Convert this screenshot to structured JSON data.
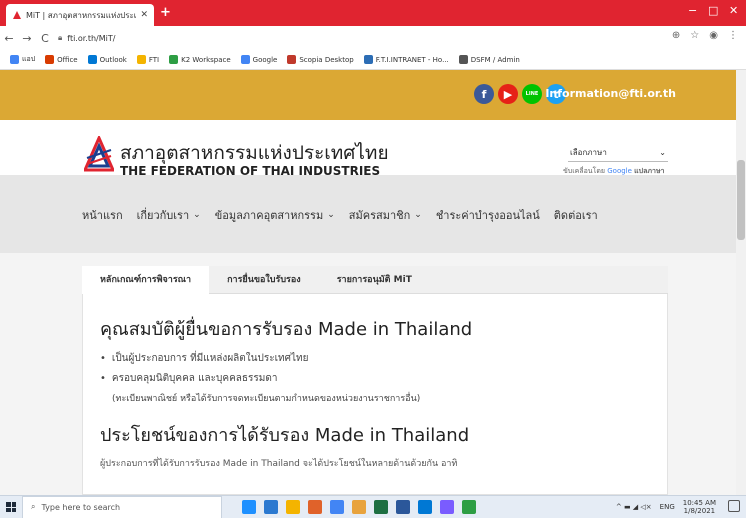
{
  "browser": {
    "tab_title": "MiT | สภาอุตสาหกรรมแห่งประเทศไทย",
    "tab_close": "✕",
    "new_tab": "+",
    "window": {
      "minimize": "−",
      "maximize": "□",
      "close": "✕"
    },
    "nav": {
      "back": "←",
      "forward": "→",
      "reload": "C"
    },
    "url": "fti.or.th/MiT/",
    "bookmarks": [
      {
        "label": "แอป",
        "color": "#4285f4"
      },
      {
        "label": "Office",
        "color": "#d83b01"
      },
      {
        "label": "Outlook",
        "color": "#0078d4"
      },
      {
        "label": "FTI",
        "color": "#f4b400"
      },
      {
        "label": "K2 Workspace",
        "color": "#2e9e44"
      },
      {
        "label": "Google",
        "color": "#4285f4"
      },
      {
        "label": "Scopia Desktop",
        "color": "#c0392b"
      },
      {
        "label": "F.T.I.INTRANET - Ho...",
        "color": "#2c6db5"
      },
      {
        "label": "DSFM / Admin",
        "color": "#555555"
      }
    ]
  },
  "header": {
    "email": "Information@fti.or.th",
    "social": [
      {
        "icon": "facebook-icon",
        "glyph": "f",
        "color": "#3b5998"
      },
      {
        "icon": "youtube-icon",
        "glyph": "▶",
        "color": "#e62117"
      },
      {
        "icon": "line-icon",
        "glyph": "LINE",
        "color": "#00c300"
      },
      {
        "icon": "twitter-icon",
        "glyph": "t",
        "color": "#1da1f2"
      }
    ],
    "title_th": "สภาอุตสาหกรรมแห่งประเทศไทย",
    "title_en": "THE FEDERATION OF THAI INDUSTRIES",
    "lang_select": "เลือกภาษา",
    "lang_note_prefix": "ขับเคลื่อนโดย",
    "lang_note_google": "Google",
    "lang_note_suffix": "แปลภาษา"
  },
  "nav": {
    "items": [
      {
        "label": "หน้าแรก",
        "dropdown": false
      },
      {
        "label": "เกี่ยวกับเรา",
        "dropdown": true
      },
      {
        "label": "ข้อมูลภาคอุตสาหกรรม",
        "dropdown": true
      },
      {
        "label": "สมัครสมาชิก",
        "dropdown": true
      },
      {
        "label": "ชำระค่าบำรุงออนไลน์",
        "dropdown": false
      },
      {
        "label": "ติดต่อเรา",
        "dropdown": false
      }
    ],
    "dropdown_glyph": "⌄"
  },
  "content": {
    "tabs": [
      "หลักเกณฑ์การพิจารณา",
      "การยื่นขอใบรับรอง",
      "รายการอนุมัติ MiT"
    ],
    "heading1": "คุณสมบัติผู้ยื่นขอการรับรอง Made in Thailand",
    "bullet1": "เป็นผู้ประกอบการ ที่มีแหล่งผลิตในประเทศไทย",
    "bullet2": "ครอบคลุมนิติบุคคล และบุคคลธรรมดา",
    "bullet2_note": "(ทะเบียนพาณิชย์ หรือได้รับการจดทะเบียนตามกำหนดของหน่วยงานราชการอื่น)",
    "heading2": "ประโยชน์ของการได้รับรอง Made in Thailand",
    "para": "ผู้ประกอบการที่ได้รับการรับรอง Made in Thailand จะได้ประโยชน์ในหลายด้านด้วยกัน อาทิ"
  },
  "taskbar": {
    "search_placeholder": "Type here to search",
    "apps": [
      "#1e90ff",
      "#2b79d0",
      "#f4b400",
      "#e0622a",
      "#4285f4",
      "#e8a33d",
      "#1d6f42",
      "#2b579a",
      "#0078d4",
      "#7a5cff",
      "#2e9e44"
    ],
    "lang": "ENG",
    "time": "10:45 AM",
    "date": "1/8/2021"
  },
  "colors": {
    "accent_red": "#e02430",
    "gold": "#dba834",
    "nav_bg": "#e6e6e6"
  }
}
